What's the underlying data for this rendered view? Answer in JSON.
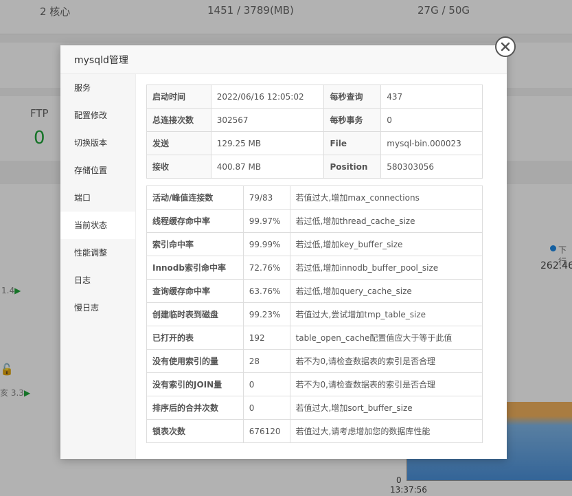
{
  "background": {
    "stats": [
      "2 核心",
      "1451 / 3789(MB)",
      "27G / 50G"
    ],
    "ftp_label": "FTP",
    "ftp_value": "0",
    "left_val1": "1.4",
    "left_val2": "3.3",
    "left_val2_prefix": "亥",
    "legend_partial": "下行",
    "legend_value": "262.46",
    "chart_y0": "0",
    "chart_time": "13:37:56"
  },
  "modal": {
    "title": "mysqld管理",
    "sidebar": [
      {
        "label": "服务"
      },
      {
        "label": "配置修改"
      },
      {
        "label": "切换版本"
      },
      {
        "label": "存储位置"
      },
      {
        "label": "端口"
      },
      {
        "label": "当前状态"
      },
      {
        "label": "性能调整"
      },
      {
        "label": "日志"
      },
      {
        "label": "慢日志"
      }
    ],
    "status_table": [
      [
        "启动时间",
        "2022/06/16 12:05:02",
        "每秒查询",
        "437"
      ],
      [
        "总连接次数",
        "302567",
        "每秒事务",
        "0"
      ],
      [
        "发送",
        "129.25 MB",
        "File",
        "mysql-bin.000023"
      ],
      [
        "接收",
        "400.87 MB",
        "Position",
        "580303056"
      ]
    ],
    "perf_table": [
      [
        "活动/峰值连接数",
        "79/83",
        "若值过大,增加max_connections"
      ],
      [
        "线程缓存命中率",
        "99.97%",
        "若过低,增加thread_cache_size"
      ],
      [
        "索引命中率",
        "99.99%",
        "若过低,增加key_buffer_size"
      ],
      [
        "Innodb索引命中率",
        "72.76%",
        "若过低,增加innodb_buffer_pool_size"
      ],
      [
        "查询缓存命中率",
        "63.76%",
        "若过低,增加query_cache_size"
      ],
      [
        "创建临时表到磁盘",
        "99.23%",
        "若值过大,尝试增加tmp_table_size"
      ],
      [
        "已打开的表",
        "192",
        "table_open_cache配置值应大于等于此值"
      ],
      [
        "没有使用索引的量",
        "28",
        "若不为0,请检查数据表的索引是否合理"
      ],
      [
        "没有索引的JOIN量",
        "0",
        "若不为0,请检查数据表的索引是否合理"
      ],
      [
        "排序后的合并次数",
        "0",
        "若值过大,增加sort_buffer_size"
      ],
      [
        "锁表次数",
        "676120",
        "若值过大,请考虑增加您的数据库性能"
      ]
    ]
  }
}
